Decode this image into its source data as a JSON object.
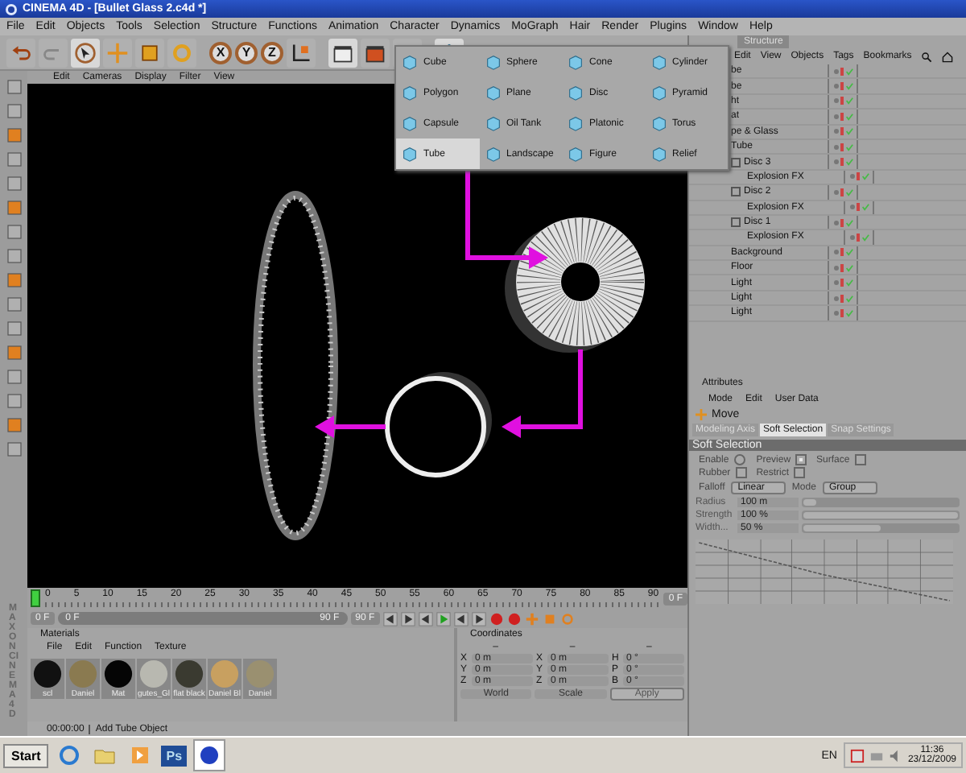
{
  "window": {
    "title": "CINEMA 4D - [Bullet Glass 2.c4d *]"
  },
  "menu_bar": [
    "File",
    "Edit",
    "Objects",
    "Tools",
    "Selection",
    "Structure",
    "Functions",
    "Animation",
    "Character",
    "Dynamics",
    "MoGraph",
    "Hair",
    "Render",
    "Plugins",
    "Window",
    "Help"
  ],
  "toolbar": {
    "axis_locks": [
      {
        "label": "X"
      },
      {
        "label": "Y"
      },
      {
        "label": "Z"
      }
    ]
  },
  "object_popup": {
    "items": [
      {
        "label": "Cube",
        "selected": false
      },
      {
        "label": "Polygon",
        "selected": false
      },
      {
        "label": "Capsule",
        "selected": false
      },
      {
        "label": "Tube",
        "selected": true
      },
      {
        "label": "Sphere",
        "selected": false
      },
      {
        "label": "Plane",
        "selected": false
      },
      {
        "label": "Oil Tank",
        "selected": false
      },
      {
        "label": "Landscape",
        "selected": false
      },
      {
        "label": "Cone",
        "selected": false
      },
      {
        "label": "Disc",
        "selected": false
      },
      {
        "label": "Platonic",
        "selected": false
      },
      {
        "label": "Figure",
        "selected": false
      },
      {
        "label": "Cylinder",
        "selected": false
      },
      {
        "label": "Pyramid",
        "selected": false
      },
      {
        "label": "Torus",
        "selected": false
      },
      {
        "label": "Relief",
        "selected": false
      }
    ]
  },
  "viewport": {
    "menu": [
      "Edit",
      "Cameras",
      "Display",
      "Filter",
      "View"
    ]
  },
  "object_manager": {
    "tabs": [
      {
        "label": "Structure",
        "selected": false
      }
    ],
    "menu": [
      "Edit",
      "View",
      "Objects",
      "Tags",
      "Bookmarks"
    ],
    "objects": [
      {
        "name": "be"
      },
      {
        "name": "be"
      },
      {
        "name": "ht"
      },
      {
        "name": "at"
      },
      {
        "name": "pe & Glass"
      },
      {
        "name": "Tube"
      },
      {
        "name": "Disc 3",
        "children": [
          {
            "name": "Explosion FX"
          }
        ]
      },
      {
        "name": "Disc 2",
        "children": [
          {
            "name": "Explosion FX"
          }
        ]
      },
      {
        "name": "Disc 1",
        "children": [
          {
            "name": "Explosion FX"
          }
        ]
      },
      {
        "name": "Background"
      },
      {
        "name": "Floor"
      },
      {
        "name": "Light"
      },
      {
        "name": "Light"
      },
      {
        "name": "Light"
      }
    ]
  },
  "attributes": {
    "header": "Attributes",
    "menu": [
      "Mode",
      "Edit",
      "User Data"
    ],
    "tool": "Move",
    "tabs": [
      {
        "label": "Modeling Axis",
        "selected": false
      },
      {
        "label": "Soft Selection",
        "selected": true
      },
      {
        "label": "Snap Settings",
        "selected": false
      }
    ],
    "section": "Soft Selection",
    "options": [
      {
        "label": "Enable",
        "kind": "radio",
        "checked": false
      },
      {
        "label": "Preview",
        "kind": "checkbox",
        "checked": true
      },
      {
        "label": "Surface",
        "kind": "checkbox",
        "checked": false
      },
      {
        "label": "Rubber",
        "kind": "checkbox",
        "checked": false
      },
      {
        "label": "Restrict",
        "kind": "checkbox",
        "checked": false
      }
    ],
    "dropdowns": [
      {
        "label": "Falloff",
        "value": "Linear"
      },
      {
        "label": "Mode",
        "value": "Group"
      }
    ],
    "sliders": [
      {
        "label": "Radius",
        "value": "100 m",
        "level": 0.08
      },
      {
        "label": "Strength",
        "value": "100 %",
        "level": 1
      },
      {
        "label": "Width...",
        "value": "50 %",
        "level": 0.5
      }
    ]
  },
  "timeline": {
    "ticks": [
      "0",
      "5",
      "10",
      "15",
      "20",
      "25",
      "30",
      "35",
      "40",
      "45",
      "50",
      "55",
      "60",
      "65",
      "70",
      "75",
      "80",
      "85",
      "90"
    ],
    "end_field": "0 F",
    "current": "0 F",
    "range": {
      "start": "0 F",
      "end": "90 F",
      "level": 1
    },
    "max_field": "90 F"
  },
  "materials": {
    "header": "Materials",
    "menu": [
      "File",
      "Edit",
      "Function",
      "Texture"
    ],
    "swatches": [
      {
        "name": "scl",
        "color": "#111111"
      },
      {
        "name": "Daniel",
        "color": "#8a7a50"
      },
      {
        "name": "Mat",
        "color": "#050505"
      },
      {
        "name": "gutes_Gl",
        "color": "#b8b8b0"
      },
      {
        "name": "flat black",
        "color": "#3a3a30"
      },
      {
        "name": "Daniel Bl",
        "color": "#c8a060"
      },
      {
        "name": "Daniel",
        "color": "#9a9070"
      }
    ]
  },
  "coordinates": {
    "header": "Coordinates",
    "columns": [
      "–",
      "–",
      "–"
    ],
    "rows": [
      [
        {
          "axis": "X",
          "value": "0 m"
        },
        {
          "axis": "X",
          "value": "0 m"
        },
        {
          "axis": "H",
          "value": "0 °"
        }
      ],
      [
        {
          "axis": "Y",
          "value": "0 m"
        },
        {
          "axis": "Y",
          "value": "0 m"
        },
        {
          "axis": "P",
          "value": "0 °"
        }
      ],
      [
        {
          "axis": "Z",
          "value": "0 m"
        },
        {
          "axis": "Z",
          "value": "0 m"
        },
        {
          "axis": "B",
          "value": "0 °"
        }
      ]
    ],
    "dropdowns": [
      "World",
      "Scale"
    ],
    "apply": "Apply"
  },
  "status_bar": {
    "time": "00:00:00",
    "message": "Add Tube Object"
  },
  "logo": {
    "brand": "MAXON",
    "product": "CINEMA 4D"
  },
  "taskbar": {
    "start": "Start",
    "photoshop": "Ps",
    "language": "EN",
    "time": "11:36",
    "date": "23/12/2009"
  }
}
